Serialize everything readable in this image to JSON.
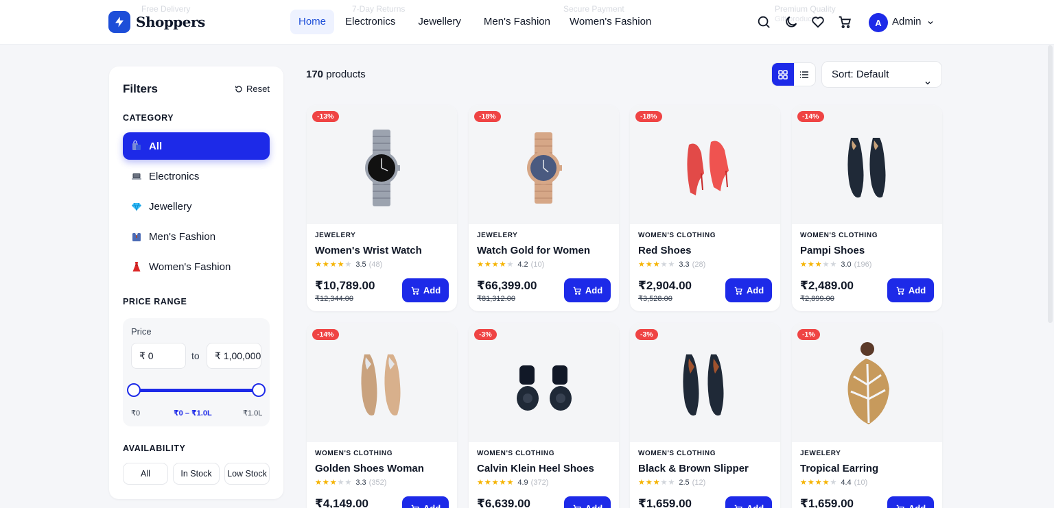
{
  "brand": {
    "name": "Shoppers",
    "accent": "#1d2ae8"
  },
  "header": {
    "ghost_features": [
      "Free Delivery",
      "7-Day Returns",
      "Secure Payment",
      "Premium Quality"
    ],
    "ghost_sub": "Gift products",
    "nav": [
      "Home",
      "Electronics",
      "Jewellery",
      "Men's Fashion",
      "Women's Fashion"
    ],
    "icons": [
      "search-icon",
      "moon-icon",
      "heart-icon",
      "cart-icon"
    ],
    "user": {
      "initial": "A",
      "name": "Admin"
    }
  },
  "sidebar": {
    "title": "Filters",
    "reset_label": "Reset",
    "category_label": "CATEGORY",
    "categories": [
      {
        "label": "All",
        "icon": "shopping-bags-icon"
      },
      {
        "label": "Electronics",
        "icon": "laptop-icon"
      },
      {
        "label": "Jewellery",
        "icon": "gem-icon"
      },
      {
        "label": "Men's Fashion",
        "icon": "suit-icon"
      },
      {
        "label": "Women's Fashion",
        "icon": "dress-icon"
      }
    ],
    "price_range_label": "PRICE RANGE",
    "price": {
      "label": "Price",
      "min_value": "₹ 0",
      "to_label": "to",
      "max_value": "₹ 1,00,000",
      "range_min_label": "₹0",
      "range_current_label": "₹0 – ₹1.0L",
      "range_max_label": "₹1.0L"
    },
    "availability_label": "AVAILABILITY",
    "availability_options": [
      "All",
      "In Stock",
      "Low Stock"
    ]
  },
  "toolbar": {
    "count": "170",
    "count_suffix": "products",
    "sort_label": "Sort: Default"
  },
  "products": [
    {
      "discount": "-13%",
      "category": "JEWELERY",
      "name": "Women's Wrist Watch",
      "rating": "3.5",
      "stars": 3.5,
      "reviews": "(48)",
      "price": "₹10,789.00",
      "old_price": "₹12,344.00",
      "add_label": "Add",
      "image": "wrist-watch-silver"
    },
    {
      "discount": "-18%",
      "category": "JEWELERY",
      "name": "Watch Gold for Women",
      "rating": "4.2",
      "stars": 4.2,
      "reviews": "(10)",
      "price": "₹66,399.00",
      "old_price": "₹81,312.00",
      "add_label": "Add",
      "image": "wrist-watch-gold"
    },
    {
      "discount": "-18%",
      "category": "WOMEN'S CLOTHING",
      "name": "Red Shoes",
      "rating": "3.3",
      "stars": 3.3,
      "reviews": "(28)",
      "price": "₹2,904.00",
      "old_price": "₹3,528.00",
      "add_label": "Add",
      "image": "red-heels"
    },
    {
      "discount": "-14%",
      "category": "WOMEN'S CLOTHING",
      "name": "Pampi Shoes",
      "rating": "3.0",
      "stars": 3.0,
      "reviews": "(196)",
      "price": "₹2,489.00",
      "old_price": "₹2,899.00",
      "add_label": "Add",
      "image": "black-heels"
    },
    {
      "discount": "-14%",
      "category": "WOMEN'S CLOTHING",
      "name": "Golden Shoes Woman",
      "rating": "3.3",
      "stars": 3.3,
      "reviews": "(352)",
      "price": "₹4,149.00",
      "old_price": "",
      "add_label": "Add",
      "image": "golden-heels"
    },
    {
      "discount": "-3%",
      "category": "WOMEN'S CLOTHING",
      "name": "Calvin Klein Heel Shoes",
      "rating": "4.9",
      "stars": 4.9,
      "reviews": "(372)",
      "price": "₹6,639.00",
      "old_price": "",
      "add_label": "Add",
      "image": "black-ankle-heels"
    },
    {
      "discount": "-3%",
      "category": "WOMEN'S CLOTHING",
      "name": "Black & Brown Slipper",
      "rating": "2.5",
      "stars": 2.5,
      "reviews": "(12)",
      "price": "₹1,659.00",
      "old_price": "",
      "add_label": "Add",
      "image": "black-brown-heels"
    },
    {
      "discount": "-1%",
      "category": "JEWELERY",
      "name": "Tropical Earring",
      "rating": "4.4",
      "stars": 4.4,
      "reviews": "(10)",
      "price": "₹1,659.00",
      "old_price": "",
      "add_label": "Add",
      "image": "leaf-earring"
    }
  ]
}
